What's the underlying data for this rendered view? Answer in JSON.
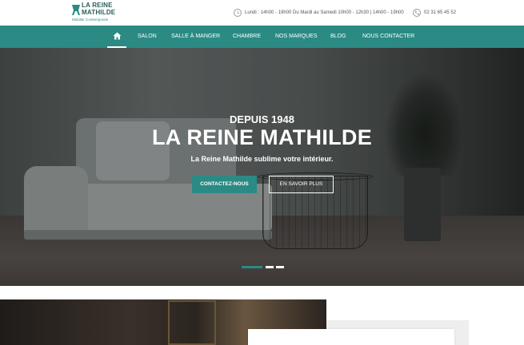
{
  "header": {
    "logo": {
      "line1": "LA REINE",
      "line2": "MATHILDE",
      "tagline": "Mobilier Contemporain"
    },
    "hours": "Lundi : 14h00 - 19h00 Du Mardi au Samedi 10h00 - 12h30 | 14h00 - 19h00",
    "phone": "02 31 65 45 52"
  },
  "nav": {
    "items": [
      "SALON",
      "SALLE À MANGER",
      "CHAMBRE",
      "NOS MARQUES",
      "BLOG",
      "NOUS CONTACTER"
    ]
  },
  "hero": {
    "kicker": "DEPUIS 1948",
    "title": "LA REINE MATHILDE",
    "subtitle": "La Reine Mathilde sublime votre intérieur.",
    "primary_cta": "CONTACTEZ-NOUS",
    "secondary_cta": "EN SAVOIR PLUS",
    "slides": {
      "count": 3,
      "active": 1
    }
  },
  "colors": {
    "brand": "#2b8a84",
    "brand_dark": "#2a5e5a"
  },
  "icons": {
    "home": "home-icon",
    "clock": "clock-icon",
    "phone": "phone-icon",
    "logo_mark": "chair-icon"
  }
}
